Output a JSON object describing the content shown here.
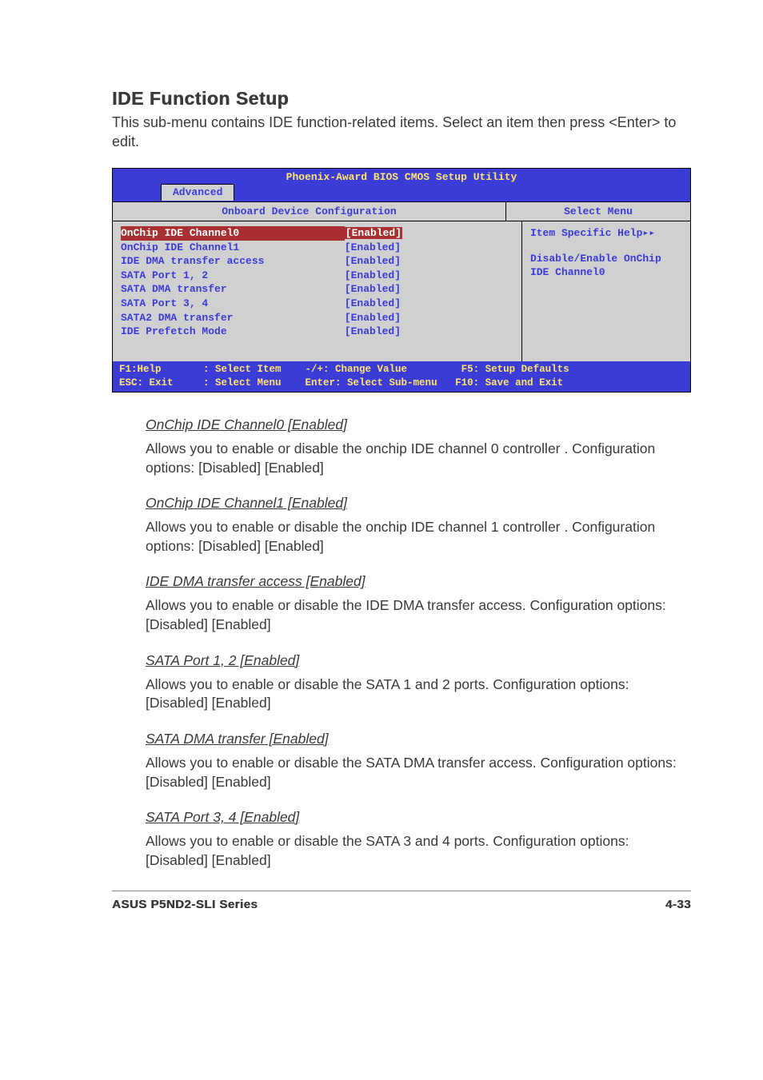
{
  "title": "IDE Function Setup",
  "intro": "This sub-menu contains IDE function-related items. Select an item then press <Enter> to edit.",
  "bios": {
    "header": "Phoenix-Award BIOS CMOS Setup Utility",
    "tab": "Advanced",
    "subtitle_left": "Onboard Device Configuration",
    "subtitle_right": "Select Menu",
    "rows": [
      {
        "label": "OnChip IDE Channel0",
        "value": "[Enabled]",
        "selected": true
      },
      {
        "label": "OnChip IDE Channel1",
        "value": "[Enabled]",
        "selected": false
      },
      {
        "label": "IDE DMA transfer access",
        "value": "[Enabled]",
        "selected": false
      },
      {
        "label": "SATA Port 1, 2",
        "value": "[Enabled]",
        "selected": false
      },
      {
        "label": "SATA DMA transfer",
        "value": "[Enabled]",
        "selected": false
      },
      {
        "label": "SATA Port 3, 4",
        "value": "[Enabled]",
        "selected": false
      },
      {
        "label": "SATA2 DMA transfer",
        "value": "[Enabled]",
        "selected": false
      },
      {
        "label": "IDE Prefetch Mode",
        "value": "[Enabled]",
        "selected": false
      }
    ],
    "help_title": "Item Specific Help",
    "help_body1": "Disable/Enable OnChip",
    "help_body2": "IDE Channel0",
    "footer_line1": "F1:Help       : Select Item    -/+: Change Value         F5: Setup Defaults",
    "footer_line2": "ESC: Exit     : Select Menu    Enter: Select Sub-menu   F10: Save and Exit"
  },
  "items": [
    {
      "title": "OnChip IDE Channel0 [Enabled]",
      "body": "Allows you to enable or disable the onchip IDE channel 0 controller . Configuration options: [Disabled] [Enabled]"
    },
    {
      "title": "OnChip IDE Channel1 [Enabled]",
      "body": "Allows you to enable or disable the onchip IDE channel 1 controller . Configuration options: [Disabled] [Enabled]"
    },
    {
      "title": "IDE DMA transfer access [Enabled]",
      "body": "Allows you to enable or disable the IDE DMA transfer access. Configuration options: [Disabled] [Enabled]"
    },
    {
      "title": "SATA Port 1, 2 [Enabled]",
      "body": "Allows you to enable or disable the SATA 1 and 2 ports. Configuration options: [Disabled] [Enabled]"
    },
    {
      "title": "SATA DMA transfer [Enabled]",
      "body": "Allows you to enable or disable the SATA DMA transfer access. Configuration options: [Disabled] [Enabled]"
    },
    {
      "title": "SATA Port 3, 4 [Enabled]",
      "body": "Allows you to enable or disable the SATA 3 and 4 ports. Configuration options: [Disabled] [Enabled]"
    }
  ],
  "footer_left": "ASUS P5ND2-SLI Series",
  "footer_right": "4-33"
}
